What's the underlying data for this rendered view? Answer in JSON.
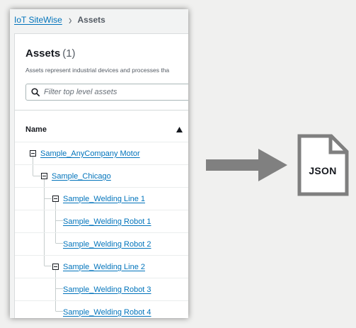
{
  "breadcrumb": {
    "root": "IoT SiteWise",
    "current": "Assets"
  },
  "panel": {
    "title": "Assets",
    "count": "(1)",
    "description": "Assets represent industrial devices and processes tha"
  },
  "search": {
    "placeholder": "Filter top level assets",
    "value": ""
  },
  "table": {
    "column_name": "Name",
    "sort": "ascending"
  },
  "tree": [
    {
      "label": "Sample_AnyCompany Motor",
      "level": 0,
      "expanded": true
    },
    {
      "label": "Sample_Chicago",
      "level": 1,
      "expanded": true
    },
    {
      "label": "Sample_Welding Line 1",
      "level": 2,
      "expanded": true
    },
    {
      "label": "Sample_Welding Robot 1",
      "level": 3,
      "expanded": null
    },
    {
      "label": "Sample_Welding Robot 2",
      "level": 3,
      "expanded": null
    },
    {
      "label": "Sample_Welding Line 2",
      "level": 2,
      "expanded": true
    },
    {
      "label": "Sample_Welding Robot 3",
      "level": 3,
      "expanded": null
    },
    {
      "label": "Sample_Welding Robot 4",
      "level": 3,
      "expanded": null
    }
  ],
  "export": {
    "arrow_icon": "right-arrow-icon",
    "file_icon": "document-icon",
    "file_label": "JSON"
  },
  "colors": {
    "link": "#0073bb",
    "text": "#16191f",
    "arrow": "#808080",
    "file_outline": "#7f7f7f",
    "background": "#f0f0ef"
  }
}
